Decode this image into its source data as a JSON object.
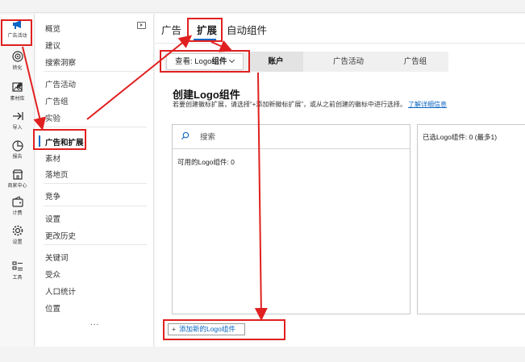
{
  "rail": {
    "items": [
      {
        "label": "广告活动",
        "icon": "megaphone-icon"
      },
      {
        "label": "转化",
        "icon": "target-icon"
      },
      {
        "label": "素材库",
        "icon": "image-edit-icon"
      },
      {
        "label": "导入",
        "icon": "import-arrow-icon"
      },
      {
        "label": "报告",
        "icon": "pie-chart-icon"
      },
      {
        "label": "商家中心",
        "icon": "store-icon"
      },
      {
        "label": "计费",
        "icon": "wallet-icon"
      },
      {
        "label": "设置",
        "icon": "gear-icon"
      },
      {
        "label": "工具",
        "icon": "tools-icon"
      }
    ]
  },
  "nav": {
    "items": [
      {
        "label": "概览"
      },
      {
        "label": "建议"
      },
      {
        "label": "搜索洞察"
      },
      {
        "label": "广告活动"
      },
      {
        "label": "广告组"
      },
      {
        "label": "实验"
      },
      {
        "label": "广告和扩展"
      },
      {
        "label": "素材"
      },
      {
        "label": "落地页"
      },
      {
        "label": "竞争"
      },
      {
        "label": "设置"
      },
      {
        "label": "更改历史"
      },
      {
        "label": "关键词"
      },
      {
        "label": "受众"
      },
      {
        "label": "人口统计"
      },
      {
        "label": "位置"
      }
    ],
    "more": "..."
  },
  "tabs": [
    "广告",
    "扩展",
    "自动组件"
  ],
  "subbar": {
    "view_prefix": "查看: Logo",
    "view_bold": "组件",
    "items": [
      "账户",
      "广告活动",
      "广告组"
    ]
  },
  "section": {
    "title": "创建Logo组件",
    "desc": "若要创建徽标扩展，请选择“+添加新徽标扩展”，或从之前创建的徽标中进行选择。",
    "link": "了解详细信息"
  },
  "panel": {
    "search_placeholder": "搜索",
    "available_label": "可用的Logo组件: 0",
    "selected_label": "已选Logo组件: 0  (最多1)"
  },
  "add_button": {
    "plus": "+",
    "label": "添加新的Logo组件"
  },
  "colors": {
    "accent": "#0b66c3",
    "annotation": "#e02020"
  }
}
